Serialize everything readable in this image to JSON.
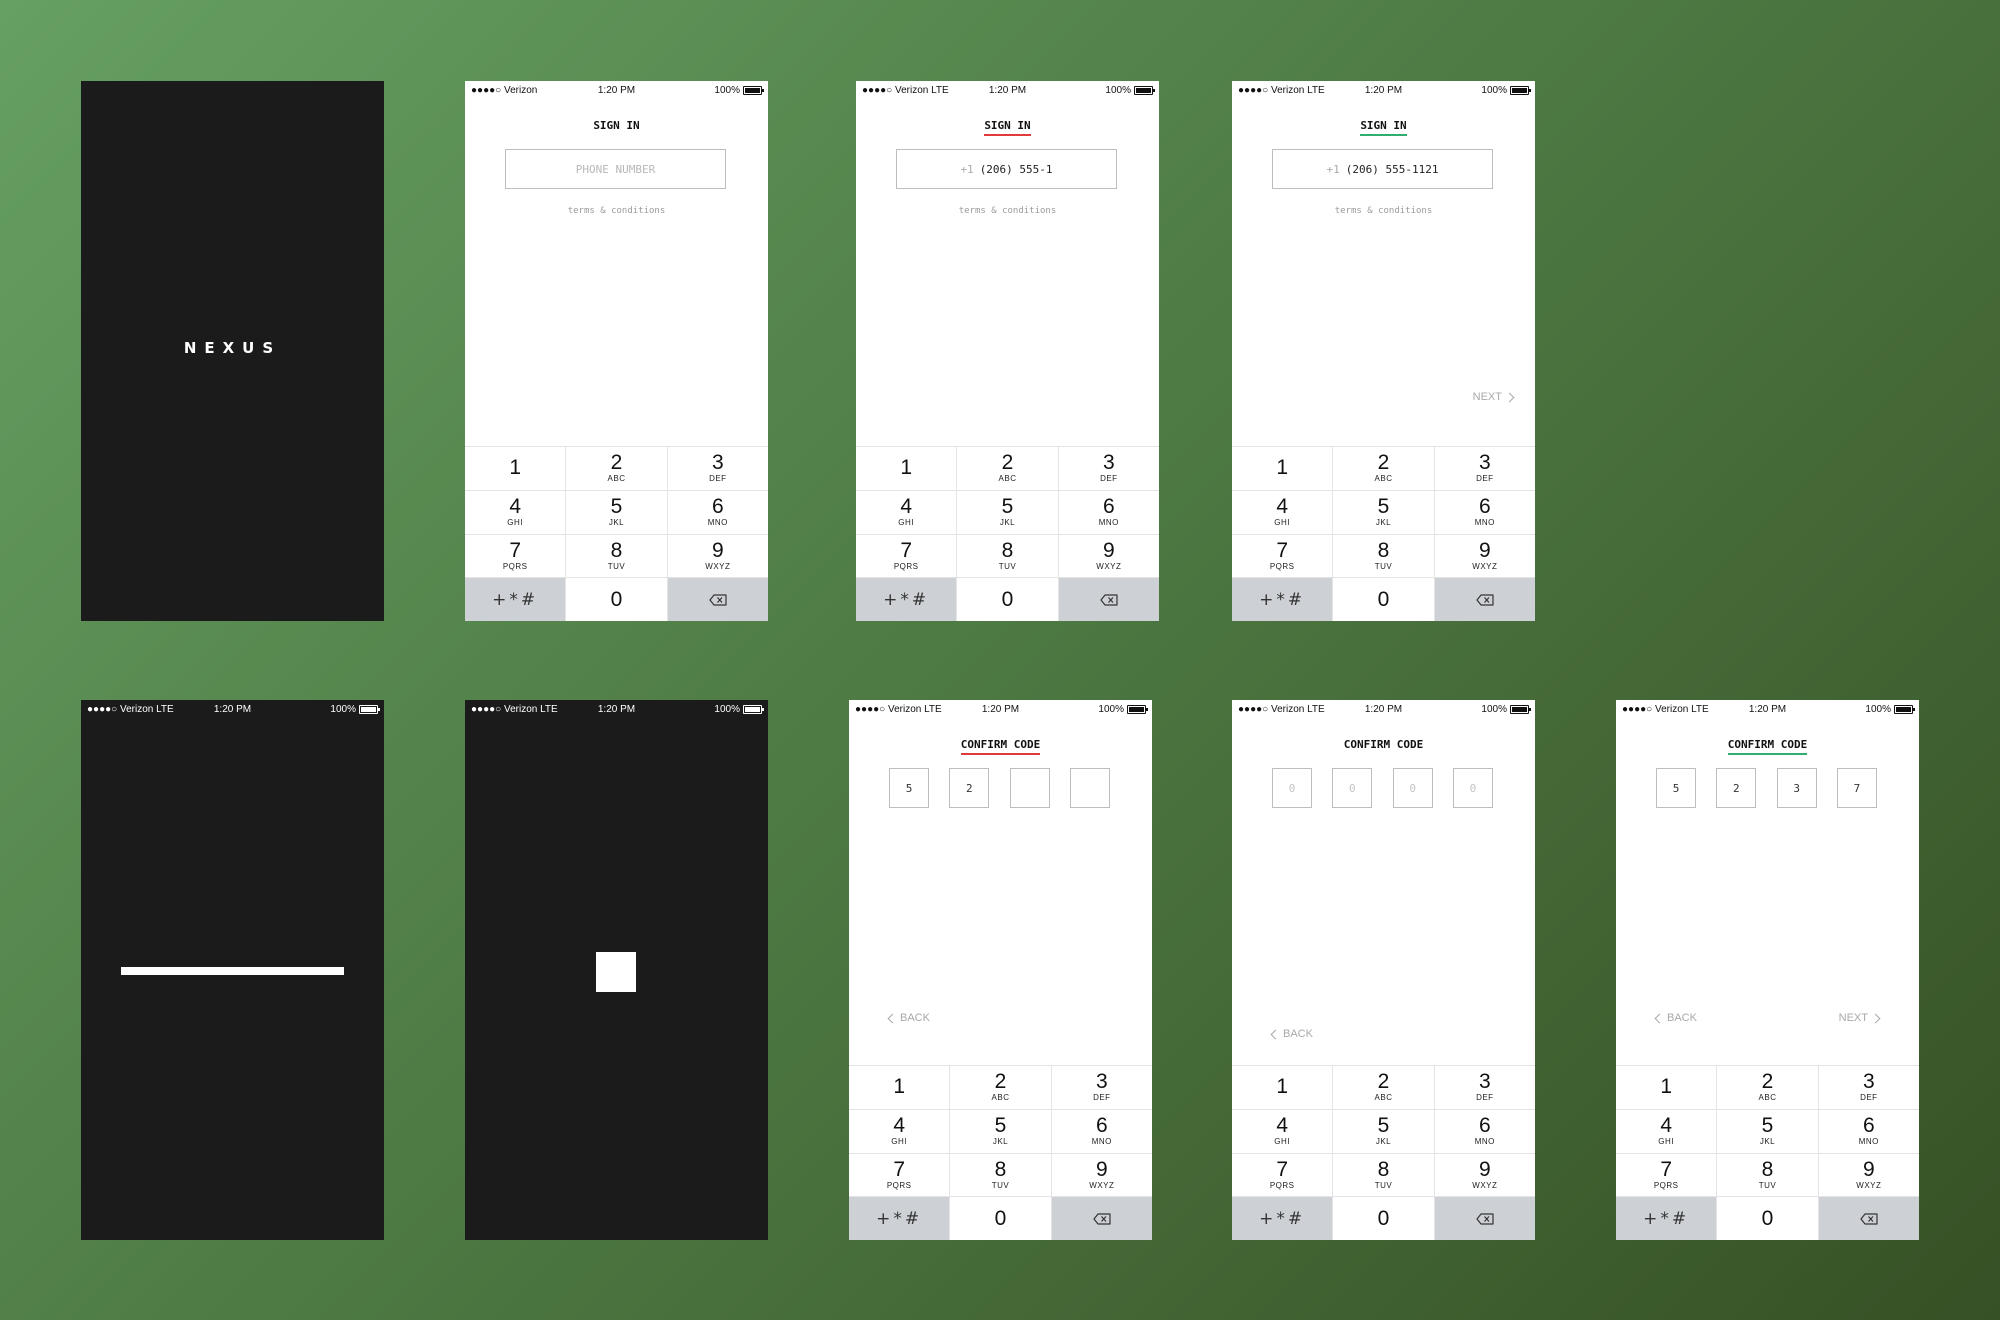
{
  "brand": {
    "logo": "NEXUS"
  },
  "status": {
    "time": "1:20 PM",
    "battery": "100%",
    "carrier_plain": "●●●●○ Verizon",
    "carrier_lte": "●●●●○ Verizon LTE"
  },
  "signin": {
    "title": "SIGN IN",
    "placeholder": "PHONE NUMBER",
    "country_code": "+1",
    "partial_number": "(206) 555-1",
    "full_number": "(206) 555-1121",
    "terms": "terms & conditions",
    "next": "NEXT"
  },
  "confirm": {
    "title": "CONFIRM CODE",
    "back": "BACK",
    "next": "NEXT",
    "partial_code": [
      "5",
      "2",
      "",
      ""
    ],
    "placeholder_code": [
      "0",
      "0",
      "0",
      "0"
    ],
    "full_code": [
      "5",
      "2",
      "3",
      "7"
    ]
  },
  "keypad": {
    "keys": [
      {
        "digit": "1",
        "letters": ""
      },
      {
        "digit": "2",
        "letters": "ABC"
      },
      {
        "digit": "3",
        "letters": "DEF"
      },
      {
        "digit": "4",
        "letters": "GHI"
      },
      {
        "digit": "5",
        "letters": "JKL"
      },
      {
        "digit": "6",
        "letters": "MNO"
      },
      {
        "digit": "7",
        "letters": "PQRS"
      },
      {
        "digit": "8",
        "letters": "TUV"
      },
      {
        "digit": "9",
        "letters": "WXYZ"
      }
    ],
    "symbols": "+*#",
    "zero": "0"
  },
  "colors": {
    "background": "#4f7c45",
    "dark_screen": "#1b1b1b",
    "accent_red": "#e03a3a",
    "accent_green": "#2fae6e",
    "key_gray": "#cdd0d5"
  }
}
